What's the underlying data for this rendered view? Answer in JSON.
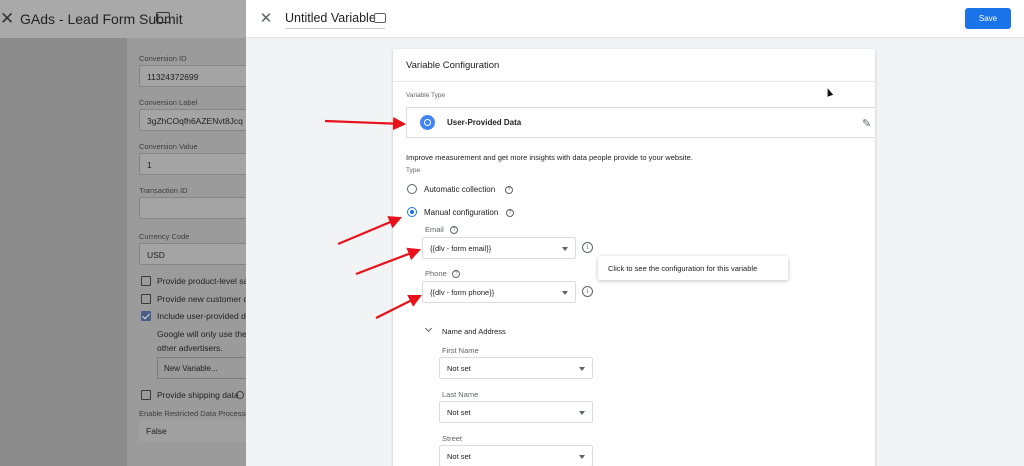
{
  "background": {
    "title": "GAds - Lead Form Submit",
    "fields": [
      {
        "label": "Conversion ID",
        "value": "11324372699"
      },
      {
        "label": "Conversion Label",
        "value": "3gZhCOqfh6AZENvt8Jcq"
      },
      {
        "label": "Conversion Value",
        "value": "1"
      },
      {
        "label": "Transaction ID",
        "value": ""
      },
      {
        "label": "Currency Code",
        "value": "USD"
      }
    ],
    "checkboxes": [
      {
        "label": "Provide product-level sale",
        "checked": false
      },
      {
        "label": "Provide new customer dat",
        "checked": false
      },
      {
        "label": "Include user-provided data",
        "checked": true
      }
    ],
    "note_line1": "Google will only use the d",
    "note_line2": "other advertisers.",
    "variable_select": "New Variable...",
    "shipping": {
      "label": "Provide shipping data",
      "checked": false
    },
    "restricted_label": "Enable Restricted Data Processing",
    "restricted_value": "False"
  },
  "sheet": {
    "variable_name": "Untitled Variable",
    "save_label": "Save",
    "card_title": "Variable Configuration",
    "variable_type_label": "Variable Type",
    "variable_type_name": "User-Provided Data",
    "description": "Improve measurement and get more insights with data people provide to your website.",
    "type_label": "Type",
    "options": [
      {
        "label": "Automatic collection",
        "selected": false
      },
      {
        "label": "Manual configuration",
        "selected": true
      }
    ],
    "email": {
      "label": "Email",
      "value": "{{dlv - form email}}"
    },
    "phone": {
      "label": "Phone",
      "value": "{{dlv - form phone}}"
    },
    "tooltip": "Click to see the configuration for this variable",
    "name_address": {
      "title": "Name and Address",
      "fields": [
        {
          "label": "First Name",
          "value": "Not set"
        },
        {
          "label": "Last Name",
          "value": "Not set"
        },
        {
          "label": "Street",
          "value": "Not set"
        }
      ]
    }
  },
  "colors": {
    "accent": "#1a73e8",
    "annotation_arrow": "#e8121b"
  },
  "icons": [
    "close-icon",
    "folder-icon",
    "gear-icon",
    "pencil-icon",
    "help-icon",
    "info-icon",
    "chevron-down-icon"
  ]
}
